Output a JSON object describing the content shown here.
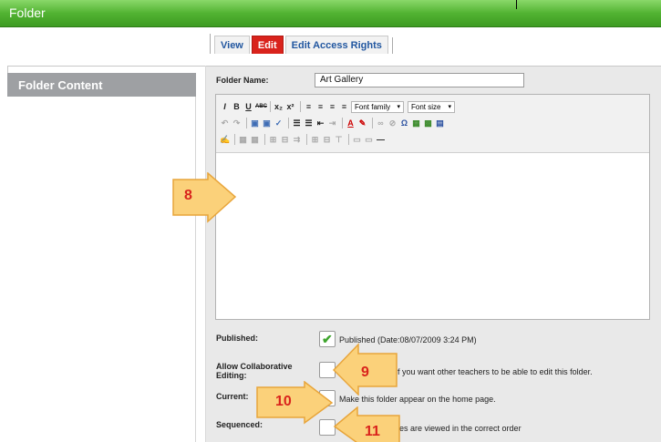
{
  "window": {
    "title": "Folder"
  },
  "tabs": [
    {
      "label": "View",
      "active": false
    },
    {
      "label": "Edit",
      "active": true
    },
    {
      "label": "Edit Access Rights",
      "active": false
    }
  ],
  "sidebar": {
    "title": "Folder Content"
  },
  "form": {
    "folder_name": {
      "label": "Folder Name:",
      "value": "Art Gallery"
    },
    "editor": {
      "font_family_select": "Font family",
      "font_size_select": "Font size",
      "toolbar_row1": [
        "I",
        "B",
        "U",
        "ABC",
        "x₂",
        "x²"
      ],
      "toolbar_row2_icons": [
        "undo-icon",
        "redo-icon",
        "paste-icon",
        "paste-text-icon",
        "spellcheck-icon",
        "bullet-list-icon",
        "numbered-list-icon",
        "outdent-icon",
        "indent-icon",
        "font-color-icon",
        "highlight-icon",
        "link-icon",
        "unlink-icon",
        "omega-icon",
        "table-icon",
        "image-icon",
        "media-icon"
      ],
      "toolbar_row3_icons": [
        "edit-html-icon",
        "table-props-icon",
        "cell-props-icon",
        "insert-row-icon",
        "delete-row-icon",
        "insert-col-icon",
        "delete-col-icon",
        "merge-icon",
        "split-icon",
        "hr-icon"
      ]
    },
    "published": {
      "label": "Published:",
      "checked": true,
      "text": "Published (Date:08/07/2009 3:24 PM)"
    },
    "collaborative": {
      "label_line1": "Allow Collaborative",
      "label_line2": "Editing:",
      "checked": false,
      "text": "x if you want other teachers to be able to edit this folder."
    },
    "current": {
      "label": "Current:",
      "checked": false,
      "text": "Make this folder appear on the home page."
    },
    "sequenced": {
      "label": "Sequenced:",
      "checked": false,
      "text": "les are viewed in the correct order"
    }
  },
  "callouts": [
    "8",
    "9",
    "10",
    "11"
  ],
  "colors": {
    "titlebar": "#52b332",
    "active_tab": "#d9231c",
    "tab_text": "#2257a0",
    "callout_fill": "#fbd17a",
    "callout_number": "#d9231c"
  }
}
